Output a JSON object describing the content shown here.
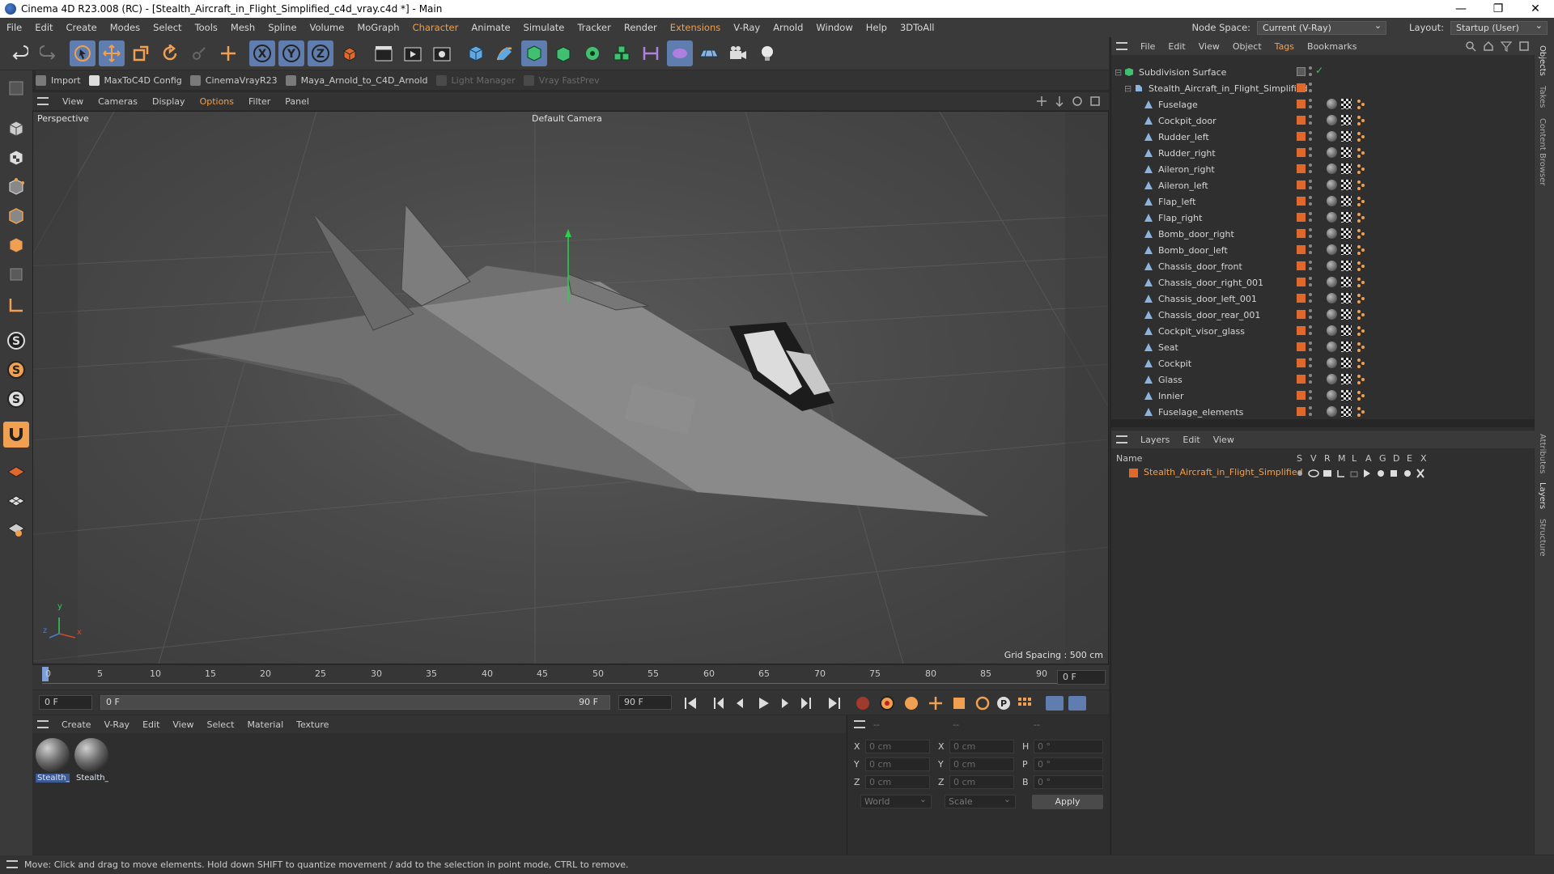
{
  "window": {
    "title": "Cinema 4D R23.008 (RC) - [Stealth_Aircraft_in_Flight_Simplified_c4d_vray.c4d *] - Main",
    "minimize": "—",
    "restore": "❐",
    "close": "✕"
  },
  "menubar": {
    "items": [
      "File",
      "Edit",
      "Create",
      "Modes",
      "Select",
      "Tools",
      "Mesh",
      "Spline",
      "Volume",
      "MoGraph",
      "Character",
      "Animate",
      "Simulate",
      "Tracker",
      "Render",
      "Extensions",
      "V-Ray",
      "Arnold",
      "Window",
      "Help",
      "3DToAll"
    ],
    "node_space_label": "Node Space:",
    "node_space_value": "Current (V-Ray)",
    "layout_label": "Layout:",
    "layout_value": "Startup (User)"
  },
  "pluginbar": {
    "items": [
      "Import",
      "MaxToC4D Config",
      "CinemaVrayR23",
      "Maya_Arnold_to_C4D_Arnold",
      "Light Manager",
      "Vray FastPrev"
    ]
  },
  "viewport": {
    "menus": [
      "View",
      "Cameras",
      "Display",
      "Options",
      "Filter",
      "Panel"
    ],
    "projection": "Perspective",
    "camera": "Default Camera",
    "grid_spacing": "Grid Spacing : 500 cm",
    "axis_y": "y",
    "axis_z": "z",
    "axis_x": "x"
  },
  "timeline": {
    "ticks": [
      "0",
      "5",
      "10",
      "15",
      "20",
      "25",
      "30",
      "35",
      "40",
      "45",
      "50",
      "55",
      "60",
      "65",
      "70",
      "75",
      "80",
      "85",
      "90"
    ],
    "current_frame_right": "0 F",
    "start_field": "0 F",
    "slider_start": "0 F",
    "slider_end": "90 F",
    "end_field": "90 F"
  },
  "material_manager": {
    "menus": [
      "Create",
      "V-Ray",
      "Edit",
      "View",
      "Select",
      "Material",
      "Texture"
    ],
    "materials": [
      "Stealth_A",
      "Stealth_A"
    ]
  },
  "coordinates": {
    "col1_header": "--",
    "col2_header": "--",
    "col3_header": "--",
    "x_pos": "0 cm",
    "y_pos": "0 cm",
    "z_pos": "0 cm",
    "x_size": "0 cm",
    "y_size": "0 cm",
    "z_size": "0 cm",
    "h_rot": "0 °",
    "p_rot": "0 °",
    "b_rot": "0 °",
    "labels": {
      "x": "X",
      "y": "Y",
      "z": "Z",
      "h": "H",
      "p": "P",
      "b": "B"
    },
    "mode_world": "World",
    "mode_scale": "Scale",
    "apply": "Apply"
  },
  "status": {
    "text": "Move: Click and drag to move elements. Hold down SHIFT to quantize movement / add to the selection in point mode, CTRL to remove."
  },
  "objects_panel": {
    "menus": [
      "File",
      "Edit",
      "View",
      "Object",
      "Tags",
      "Bookmarks"
    ],
    "root": "Subdivision Surface",
    "group": "Stealth_Aircraft_in_Flight_Simplified",
    "children": [
      "Fuselage",
      "Cockpit_door",
      "Rudder_left",
      "Rudder_right",
      "Aileron_right",
      "Aileron_left",
      "Flap_left",
      "Flap_right",
      "Bomb_door_right",
      "Bomb_door_left",
      "Chassis_door_front",
      "Chassis_door_right_001",
      "Chassis_door_left_001",
      "Chassis_door_rear_001",
      "Cockpit_visor_glass",
      "Seat",
      "Cockpit",
      "Glass",
      "Innier",
      "Fuselage_elements"
    ]
  },
  "layers_panel": {
    "menus": [
      "Layers",
      "Edit",
      "View"
    ],
    "name_header": "Name",
    "columns": [
      "S",
      "V",
      "R",
      "M",
      "L",
      "A",
      "G",
      "D",
      "E",
      "X"
    ],
    "layer_name": "Stealth_Aircraft_in_Flight_Simplified"
  },
  "side_tabs": [
    "Objects",
    "Takes",
    "Content Browser",
    "Attributes",
    "Layers",
    "Structure"
  ],
  "colors": {
    "accent_orange": "#f0a050",
    "layer_orange": "#e0682a",
    "selection_blue": "#5f7dae"
  }
}
